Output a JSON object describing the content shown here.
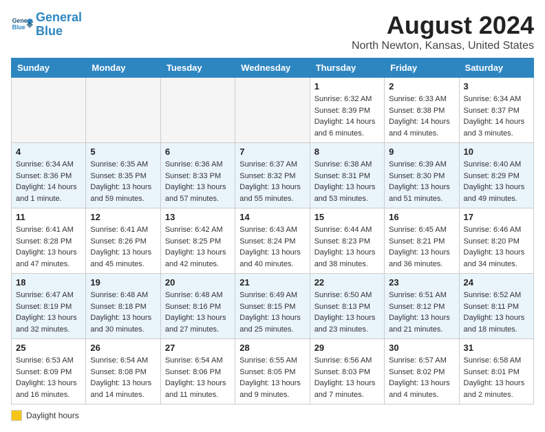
{
  "header": {
    "logo_line1": "General",
    "logo_line2": "Blue",
    "month": "August 2024",
    "location": "North Newton, Kansas, United States"
  },
  "days_of_week": [
    "Sunday",
    "Monday",
    "Tuesday",
    "Wednesday",
    "Thursday",
    "Friday",
    "Saturday"
  ],
  "weeks": [
    [
      {
        "day": "",
        "empty": true
      },
      {
        "day": "",
        "empty": true
      },
      {
        "day": "",
        "empty": true
      },
      {
        "day": "",
        "empty": true
      },
      {
        "day": "1",
        "sunrise": "6:32 AM",
        "sunset": "8:39 PM",
        "daylight": "14 hours and 6 minutes."
      },
      {
        "day": "2",
        "sunrise": "6:33 AM",
        "sunset": "8:38 PM",
        "daylight": "14 hours and 4 minutes."
      },
      {
        "day": "3",
        "sunrise": "6:34 AM",
        "sunset": "8:37 PM",
        "daylight": "14 hours and 3 minutes."
      }
    ],
    [
      {
        "day": "4",
        "sunrise": "6:34 AM",
        "sunset": "8:36 PM",
        "daylight": "14 hours and 1 minute."
      },
      {
        "day": "5",
        "sunrise": "6:35 AM",
        "sunset": "8:35 PM",
        "daylight": "13 hours and 59 minutes."
      },
      {
        "day": "6",
        "sunrise": "6:36 AM",
        "sunset": "8:33 PM",
        "daylight": "13 hours and 57 minutes."
      },
      {
        "day": "7",
        "sunrise": "6:37 AM",
        "sunset": "8:32 PM",
        "daylight": "13 hours and 55 minutes."
      },
      {
        "day": "8",
        "sunrise": "6:38 AM",
        "sunset": "8:31 PM",
        "daylight": "13 hours and 53 minutes."
      },
      {
        "day": "9",
        "sunrise": "6:39 AM",
        "sunset": "8:30 PM",
        "daylight": "13 hours and 51 minutes."
      },
      {
        "day": "10",
        "sunrise": "6:40 AM",
        "sunset": "8:29 PM",
        "daylight": "13 hours and 49 minutes."
      }
    ],
    [
      {
        "day": "11",
        "sunrise": "6:41 AM",
        "sunset": "8:28 PM",
        "daylight": "13 hours and 47 minutes."
      },
      {
        "day": "12",
        "sunrise": "6:41 AM",
        "sunset": "8:26 PM",
        "daylight": "13 hours and 45 minutes."
      },
      {
        "day": "13",
        "sunrise": "6:42 AM",
        "sunset": "8:25 PM",
        "daylight": "13 hours and 42 minutes."
      },
      {
        "day": "14",
        "sunrise": "6:43 AM",
        "sunset": "8:24 PM",
        "daylight": "13 hours and 40 minutes."
      },
      {
        "day": "15",
        "sunrise": "6:44 AM",
        "sunset": "8:23 PM",
        "daylight": "13 hours and 38 minutes."
      },
      {
        "day": "16",
        "sunrise": "6:45 AM",
        "sunset": "8:21 PM",
        "daylight": "13 hours and 36 minutes."
      },
      {
        "day": "17",
        "sunrise": "6:46 AM",
        "sunset": "8:20 PM",
        "daylight": "13 hours and 34 minutes."
      }
    ],
    [
      {
        "day": "18",
        "sunrise": "6:47 AM",
        "sunset": "8:19 PM",
        "daylight": "13 hours and 32 minutes."
      },
      {
        "day": "19",
        "sunrise": "6:48 AM",
        "sunset": "8:18 PM",
        "daylight": "13 hours and 30 minutes."
      },
      {
        "day": "20",
        "sunrise": "6:48 AM",
        "sunset": "8:16 PM",
        "daylight": "13 hours and 27 minutes."
      },
      {
        "day": "21",
        "sunrise": "6:49 AM",
        "sunset": "8:15 PM",
        "daylight": "13 hours and 25 minutes."
      },
      {
        "day": "22",
        "sunrise": "6:50 AM",
        "sunset": "8:13 PM",
        "daylight": "13 hours and 23 minutes."
      },
      {
        "day": "23",
        "sunrise": "6:51 AM",
        "sunset": "8:12 PM",
        "daylight": "13 hours and 21 minutes."
      },
      {
        "day": "24",
        "sunrise": "6:52 AM",
        "sunset": "8:11 PM",
        "daylight": "13 hours and 18 minutes."
      }
    ],
    [
      {
        "day": "25",
        "sunrise": "6:53 AM",
        "sunset": "8:09 PM",
        "daylight": "13 hours and 16 minutes."
      },
      {
        "day": "26",
        "sunrise": "6:54 AM",
        "sunset": "8:08 PM",
        "daylight": "13 hours and 14 minutes."
      },
      {
        "day": "27",
        "sunrise": "6:54 AM",
        "sunset": "8:06 PM",
        "daylight": "13 hours and 11 minutes."
      },
      {
        "day": "28",
        "sunrise": "6:55 AM",
        "sunset": "8:05 PM",
        "daylight": "13 hours and 9 minutes."
      },
      {
        "day": "29",
        "sunrise": "6:56 AM",
        "sunset": "8:03 PM",
        "daylight": "13 hours and 7 minutes."
      },
      {
        "day": "30",
        "sunrise": "6:57 AM",
        "sunset": "8:02 PM",
        "daylight": "13 hours and 4 minutes."
      },
      {
        "day": "31",
        "sunrise": "6:58 AM",
        "sunset": "8:01 PM",
        "daylight": "13 hours and 2 minutes."
      }
    ]
  ],
  "legend": {
    "label": "Daylight hours"
  }
}
